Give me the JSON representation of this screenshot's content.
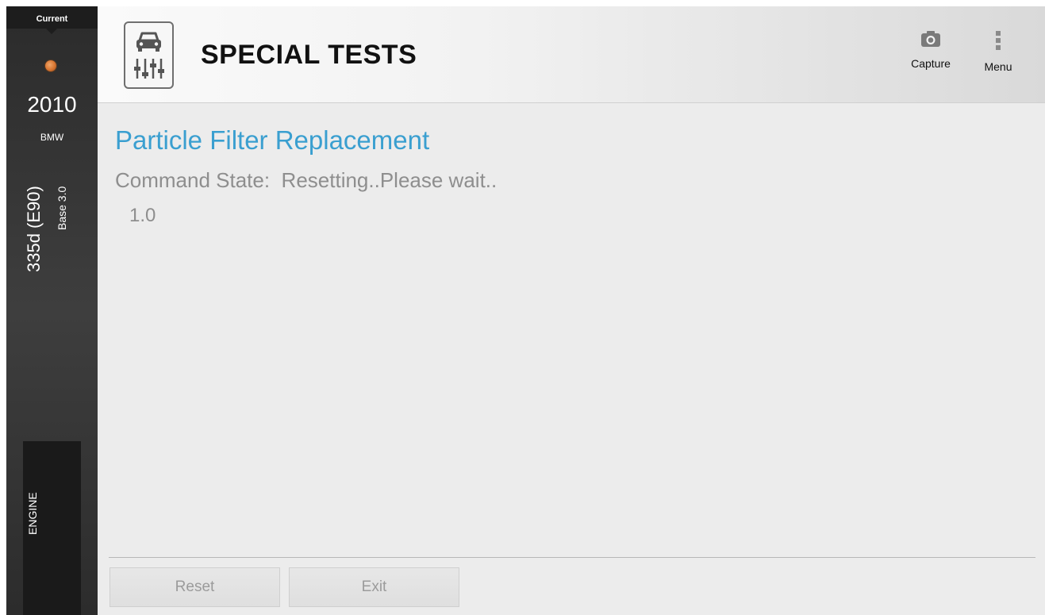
{
  "vehicle": {
    "current_label": "Current",
    "year": "2010",
    "make": "BMW",
    "model": "335d (E90)",
    "trim": "Base 3.0",
    "system_tab": "ENGINE"
  },
  "header": {
    "title": "SPECIAL TESTS",
    "capture_label": "Capture",
    "menu_label": "Menu"
  },
  "test": {
    "name": "Particle Filter Replacement",
    "state_label": "Command State:",
    "state_value": "Resetting..Please wait..",
    "value": "1.0"
  },
  "footer": {
    "reset_label": "Reset",
    "exit_label": "Exit"
  },
  "colors": {
    "accent": "#3a9fd0",
    "connection_status": "#d8742f"
  }
}
